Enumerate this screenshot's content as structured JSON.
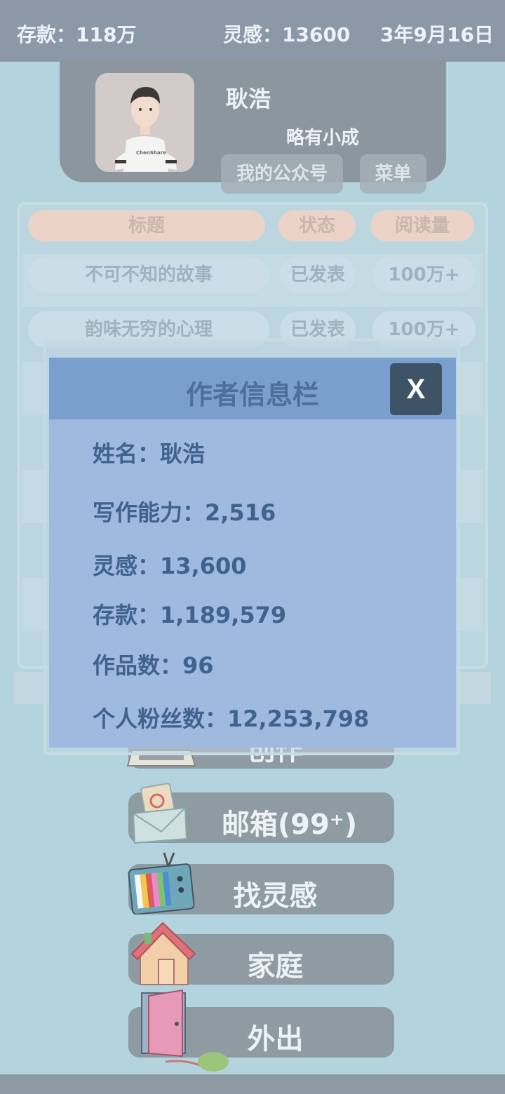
{
  "status_bar": {
    "savings": "存款：118万",
    "inspiration": "灵感：13600",
    "date": "3年9月16日"
  },
  "profile": {
    "name": "耿浩",
    "rank": "略有小成",
    "public_account_button": "我的公众号",
    "menu_button": "菜单"
  },
  "works_table": {
    "headers": [
      "标题",
      "状态",
      "阅读量"
    ],
    "rows": [
      {
        "title": "不可不知的故事",
        "status": "已发表",
        "reads": "100万+"
      },
      {
        "title": "韵味无穷的心理",
        "status": "已发表",
        "reads": "100万+"
      }
    ]
  },
  "menu": {
    "create": "创作",
    "mailbox": "邮箱(99⁺)",
    "find_inspiration": "找灵感",
    "family": "家庭",
    "go_out": "外出"
  },
  "author_modal": {
    "title": "作者信息栏",
    "close": "X",
    "name": "姓名：耿浩",
    "writing_ability": "写作能力：2,516",
    "inspiration": "灵感：13,600",
    "savings": "存款：1,189,579",
    "works_count": "作品数：96",
    "fans": "个人粉丝数：12,253,798"
  },
  "colors": {
    "background": "#b3d4de",
    "modal_body": "#9fb9df",
    "modal_header": "#7a9fcf",
    "close_button": "#3f5366",
    "header_pill": "#ecd3c7"
  }
}
